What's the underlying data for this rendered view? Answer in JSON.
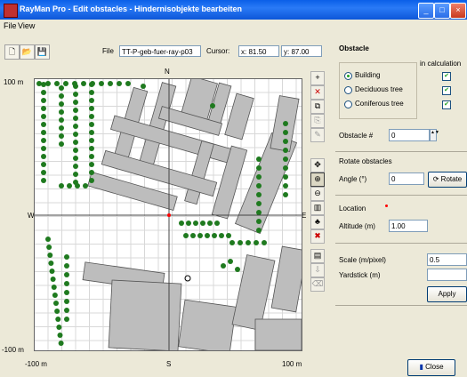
{
  "window": {
    "title": "RayMan Pro - Edit obstacles - Hindernisobjekte bearbeiten"
  },
  "menu": {
    "file": "File",
    "view": "View"
  },
  "toolbar": {
    "file_label": "File",
    "file_value": "TT-P-geb-fuer-ray-p03",
    "cursor_label": "Cursor:",
    "cursor_x": "x: 81.50",
    "cursor_y": "y: 87.00"
  },
  "map": {
    "north": "N",
    "south": "S",
    "west": "W",
    "east": "E",
    "y_top": "100 m",
    "y_bottom": "-100 m",
    "x_left": "-100 m",
    "x_right": "100 m"
  },
  "obstacle": {
    "group_title": "Obstacle",
    "in_calc_label": "in calculation",
    "types": [
      {
        "label": "Building",
        "selected": true,
        "in_calc": true
      },
      {
        "label": "Deciduous tree",
        "selected": false,
        "in_calc": true
      },
      {
        "label": "Coniferous tree",
        "selected": false,
        "in_calc": true
      }
    ],
    "number_label": "Obstacle #",
    "number_value": "0"
  },
  "rotate": {
    "group_title": "Rotate obstacles",
    "angle_label": "Angle (°)",
    "angle_value": "0",
    "rotate_button": "Rotate"
  },
  "location": {
    "title": "Location",
    "altitude_label": "Altitude (m)",
    "altitude_value": "1.00"
  },
  "scale": {
    "scale_label": "Scale (m/pixel)",
    "scale_value": "0.5",
    "yardstick_label": "Yardstick (m)",
    "yardstick_value": "",
    "apply_button": "Apply"
  },
  "footer": {
    "close_button": "Close"
  },
  "colors": {
    "tree": "#1f7a1f",
    "building": "#bdbdbd",
    "marker": "#ff0000"
  }
}
